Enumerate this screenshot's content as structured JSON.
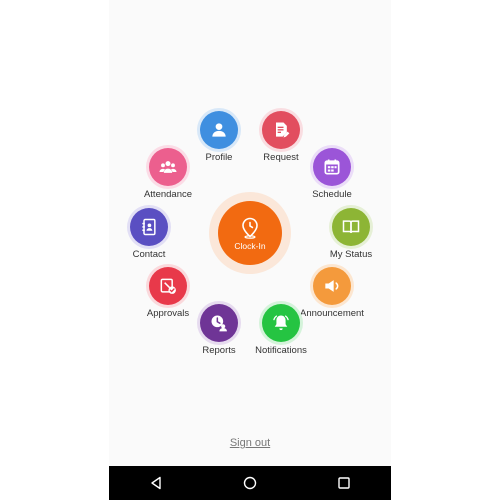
{
  "menu": {
    "profile": {
      "label": "Profile",
      "color": "#3f8fe0",
      "ring": "#d8e8f8",
      "icon": "person-icon"
    },
    "request": {
      "label": "Request",
      "color": "#e24e5f",
      "ring": "#f9dde1",
      "icon": "document-edit-icon"
    },
    "schedule": {
      "label": "Schedule",
      "color": "#9b55d8",
      "ring": "#ebddf8",
      "icon": "calendar-icon"
    },
    "my_status": {
      "label": "My Status",
      "color": "#8db535",
      "ring": "#e6f0d6",
      "icon": "book-icon"
    },
    "announcement": {
      "label": "Announcement",
      "color": "#f49a3c",
      "ring": "#fce6d0",
      "icon": "speaker-icon"
    },
    "notifications": {
      "label": "Notifications",
      "color": "#25c442",
      "ring": "#d4f3da",
      "icon": "bell-icon"
    },
    "reports": {
      "label": "Reports",
      "color": "#6f3596",
      "ring": "#e6dbef",
      "icon": "report-clock-icon"
    },
    "approvals": {
      "label": "Approvals",
      "color": "#e8394a",
      "ring": "#fad9dc",
      "icon": "approval-check-icon"
    },
    "contact": {
      "label": "Contact",
      "color": "#5a4fc2",
      "ring": "#e2dff5",
      "icon": "contact-book-icon"
    },
    "attendance": {
      "label": "Attendance",
      "color": "#ec5f8e",
      "ring": "#fbdce6",
      "icon": "group-icon"
    }
  },
  "clock_in": {
    "label": "Clock-In",
    "color": "#f26a11"
  },
  "sign_out_label": "Sign out",
  "navbar": {
    "icons": [
      "back-triangle-icon",
      "home-circle-icon",
      "recents-square-icon"
    ]
  }
}
